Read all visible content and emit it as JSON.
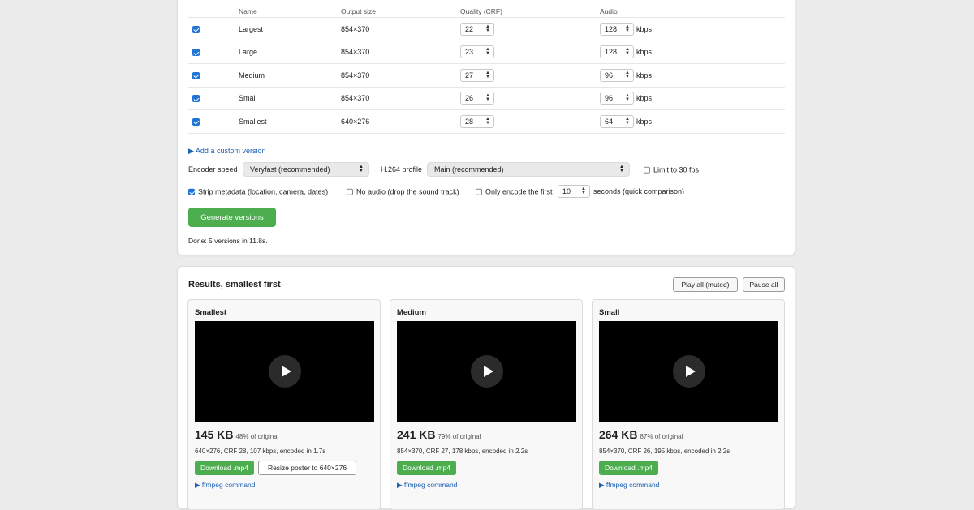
{
  "table": {
    "headers": {
      "name": "Name",
      "size": "Output size",
      "crf": "Quality (CRF)",
      "audio": "Audio"
    },
    "audio_unit": "kbps",
    "rows": [
      {
        "checked": true,
        "name": "Largest",
        "size": "854×370",
        "crf": "22",
        "audio": "128"
      },
      {
        "checked": true,
        "name": "Large",
        "size": "854×370",
        "crf": "23",
        "audio": "128"
      },
      {
        "checked": true,
        "name": "Medium",
        "size": "854×370",
        "crf": "27",
        "audio": "96"
      },
      {
        "checked": true,
        "name": "Small",
        "size": "854×370",
        "crf": "26",
        "audio": "96"
      },
      {
        "checked": true,
        "name": "Smallest",
        "size": "640×276",
        "crf": "28",
        "audio": "64"
      }
    ]
  },
  "add_custom_label": "▶ Add a custom version",
  "options": {
    "encoder_speed_label": "Encoder speed",
    "encoder_speed_value": "Veryfast (recommended)",
    "profile_label": "H.264 profile",
    "profile_value": "Main (recommended)",
    "limit_fps_label": "Limit to 30 fps",
    "limit_fps_checked": false,
    "strip_metadata_label": "Strip metadata (location, camera, dates)",
    "strip_metadata_checked": true,
    "no_audio_label": "No audio (drop the sound track)",
    "no_audio_checked": false,
    "only_encode_label": "Only encode the first",
    "only_encode_checked": false,
    "only_encode_value": "10",
    "only_encode_suffix": "seconds (quick comparison)"
  },
  "generate_label": "Generate versions",
  "status_text": "Done: 5 versions in 11.8s.",
  "results": {
    "title": "Results, smallest first",
    "play_all_label": "Play all (muted)",
    "pause_all_label": "Pause all",
    "download_label": "Download .mp4",
    "ffmpeg_label": "▶ ffmpeg command",
    "cards": [
      {
        "name": "Smallest",
        "size": "145 KB",
        "pct": "48% of original",
        "meta": "640×276, CRF 28, 107 kbps, encoded in 1.7s",
        "resize_label": "Resize poster to 640×276"
      },
      {
        "name": "Medium",
        "size": "241 KB",
        "pct": "79% of original",
        "meta": "854×370, CRF 27, 178 kbps, encoded in 2.2s"
      },
      {
        "name": "Small",
        "size": "264 KB",
        "pct": "87% of original",
        "meta": "854×370, CRF 26, 195 kbps, encoded in 2.2s"
      }
    ]
  },
  "colors": {
    "accent_green": "#4cae4f",
    "link_blue": "#1a5fb4",
    "check_blue": "#1f74d6"
  }
}
